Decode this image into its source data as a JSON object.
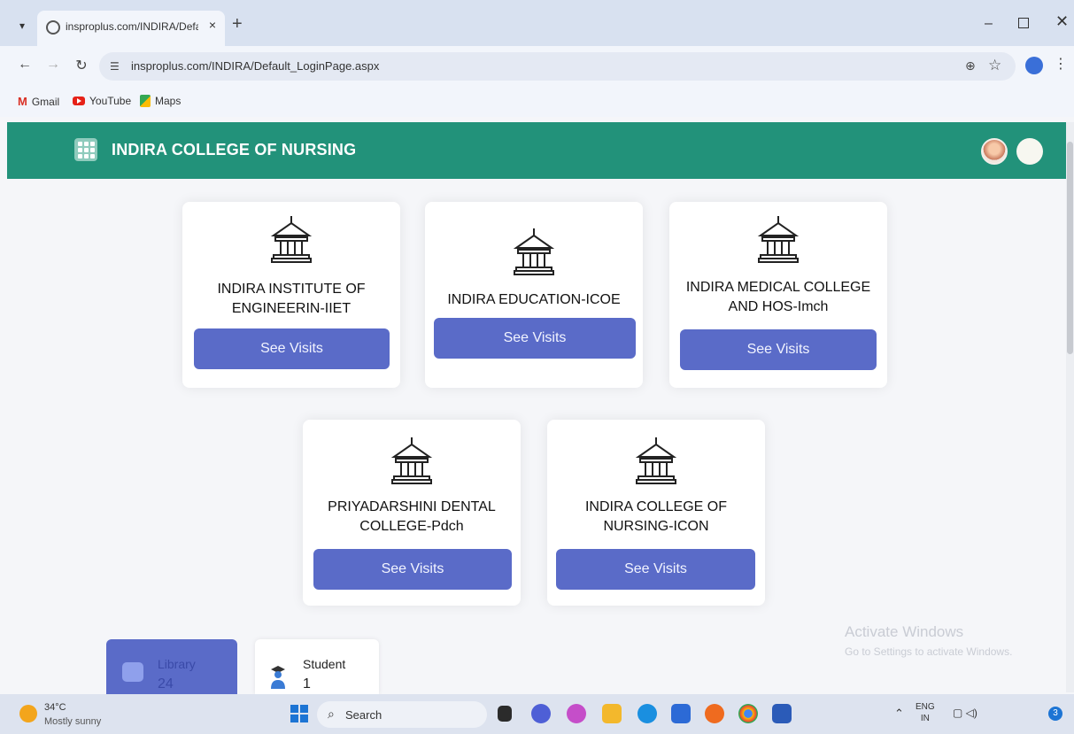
{
  "browser": {
    "tab_title": "insproplus.com/INDIRA/Defaul",
    "new_tab": "+",
    "close": "×",
    "url": "insproplus.com/INDIRA/Default_LoginPage.aspx",
    "bookmarks": [
      {
        "label": "Gmail"
      },
      {
        "label": "YouTube"
      },
      {
        "label": "Maps"
      }
    ]
  },
  "header": {
    "title": "INDIRA COLLEGE OF NURSING",
    "color": "#22927a"
  },
  "colleges": [
    {
      "name": "INDIRA INSTITUTE OF ENGINEERIN-IIET",
      "button": "See Visits"
    },
    {
      "name": "INDIRA EDUCATION-ICOE",
      "button": "See Visits"
    },
    {
      "name": "INDIRA MEDICAL COLLEGE AND HOS-Imch",
      "button": "See Visits"
    },
    {
      "name": "PRIYADARSHINI DENTAL COLLEGE-Pdch",
      "button": "See Visits"
    },
    {
      "name": "INDIRA COLLEGE OF NURSING-ICON",
      "button": "See Visits"
    }
  ],
  "stats": {
    "library": {
      "label": "Library",
      "count": "24"
    },
    "student": {
      "label": "Student",
      "count": "1"
    }
  },
  "watermark": {
    "title": "Activate Windows",
    "subtitle": "Go to Settings to activate Windows."
  },
  "taskbar": {
    "temperature": "34°C",
    "weather": "Mostly sunny",
    "search_placeholder": "Search",
    "lang_1": "ENG",
    "lang_2": "IN",
    "notifications": "3"
  },
  "colors": {
    "accent": "#5a6bc8",
    "header": "#22927a"
  }
}
